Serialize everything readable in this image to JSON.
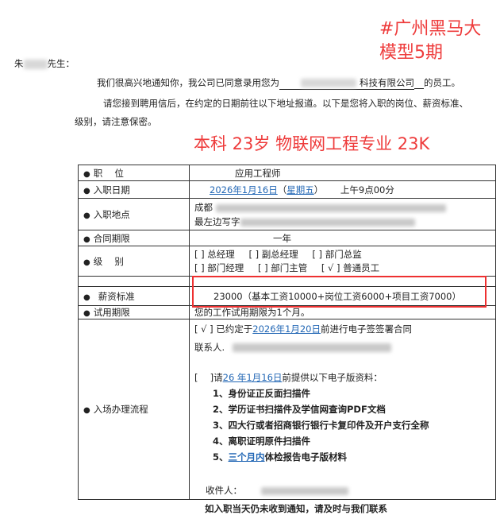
{
  "overlay": {
    "tag_line1": "#广州黑马大",
    "tag_line2": "模型5期",
    "summary": "本科 23岁 物联网工程专业 23K"
  },
  "letter": {
    "salutation_prefix": "朱",
    "salutation_suffix": "先生：",
    "p1_start": "我们很高兴地通知你，我公司已同意录用您为",
    "p1_company_suffix": "科技有限公司",
    "p1_end": "的员工。",
    "p2_line1": "请您接到聘用信后，在约定的日期前往以下地址报道。以下是您将入职的岗位、薪资标准、",
    "p2_line2": "级别，请注意保密。"
  },
  "table": {
    "position": {
      "label": "职　 位",
      "value": "应用工程师"
    },
    "start_date": {
      "label": "入职日期",
      "date": "2026年1月16日",
      "weekday": "星期五",
      "time": "上午9点00分"
    },
    "location": {
      "label": "入职地点",
      "line1_prefix": "成都",
      "line2_prefix": "最左边写字"
    },
    "contract": {
      "label": "合同期限",
      "value": "一年"
    },
    "level": {
      "label": "级　 别",
      "row1": [
        "[ ] 总经理",
        "[ ] 副总经理",
        "[ ] 部门总监"
      ],
      "row2": [
        "[ ] 部门经理",
        "[ ] 部门主管",
        "[ √ ] 普通员工"
      ]
    },
    "salary": {
      "label": "薪资标准",
      "value": "23000（基本工资10000+岗位工资6000+项目工资7000）"
    },
    "probation": {
      "label": "试用期限",
      "value": "您的工作试用期限为1个月。"
    },
    "process": {
      "label": "入场办理流程",
      "contract_prefix": "[ √ ] 已约定于",
      "contract_date": "2026年1月20日",
      "contract_suffix": "前进行电子签签署合同",
      "contact_label": "联系人.",
      "docs_prefix": "[　 ]请",
      "docs_date": "26 年1月16日",
      "docs_suffix": "前提供以下电子版资料：",
      "item1": "1、身份证正反面扫描件",
      "item2": "2、学历证书扫描件及学信网查询PDF文档",
      "item3": "3、四大行或者招商银行银行卡复印件及开户支行全称",
      "item4": "4、离职证明原件扫描件",
      "item5_prefix": "5、",
      "item5_link": "三个月内",
      "item5_suffix": "体检报告电子版材料",
      "receiver_label": "收件人："
    }
  },
  "footer_partial": "如入职当天仍未收到通知，请及时与我们联系"
}
